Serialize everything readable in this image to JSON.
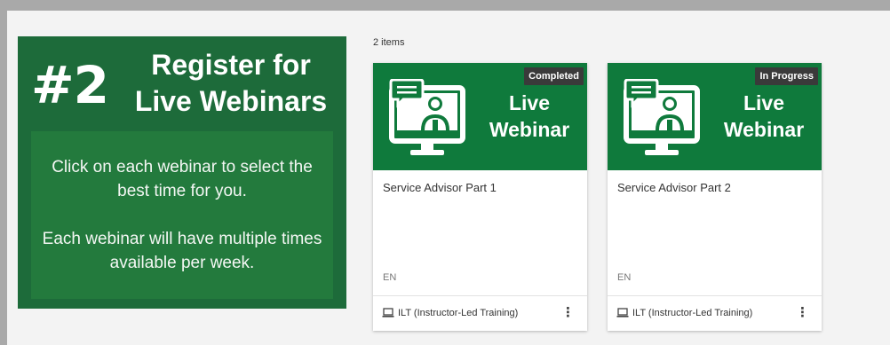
{
  "banner": {
    "number": "#2",
    "title_line1": "Register for",
    "title_line2": "Live Webinars",
    "text1": "Click on each webinar to select the best time for you.",
    "text2": "Each webinar will have multiple times available per week."
  },
  "catalog": {
    "count_label": "2 items",
    "cards": [
      {
        "thumb_line1": "Live",
        "thumb_line2": "Webinar",
        "status": "Completed",
        "title": "Service Advisor Part 1",
        "language": "EN",
        "type": "ILT (Instructor-Led Training)",
        "menu_icon": "more-vert-icon"
      },
      {
        "thumb_line1": "Live",
        "thumb_line2": "Webinar",
        "status": "In Progress",
        "title": "Service Advisor Part 2",
        "language": "EN",
        "type": "ILT (Instructor-Led Training)",
        "menu_icon": "more-vert-icon"
      }
    ]
  },
  "colors": {
    "banner_bg": "#1d6b3a",
    "thumb_bg": "#0f7a3c",
    "badge_bg": "#3a3a3a"
  }
}
